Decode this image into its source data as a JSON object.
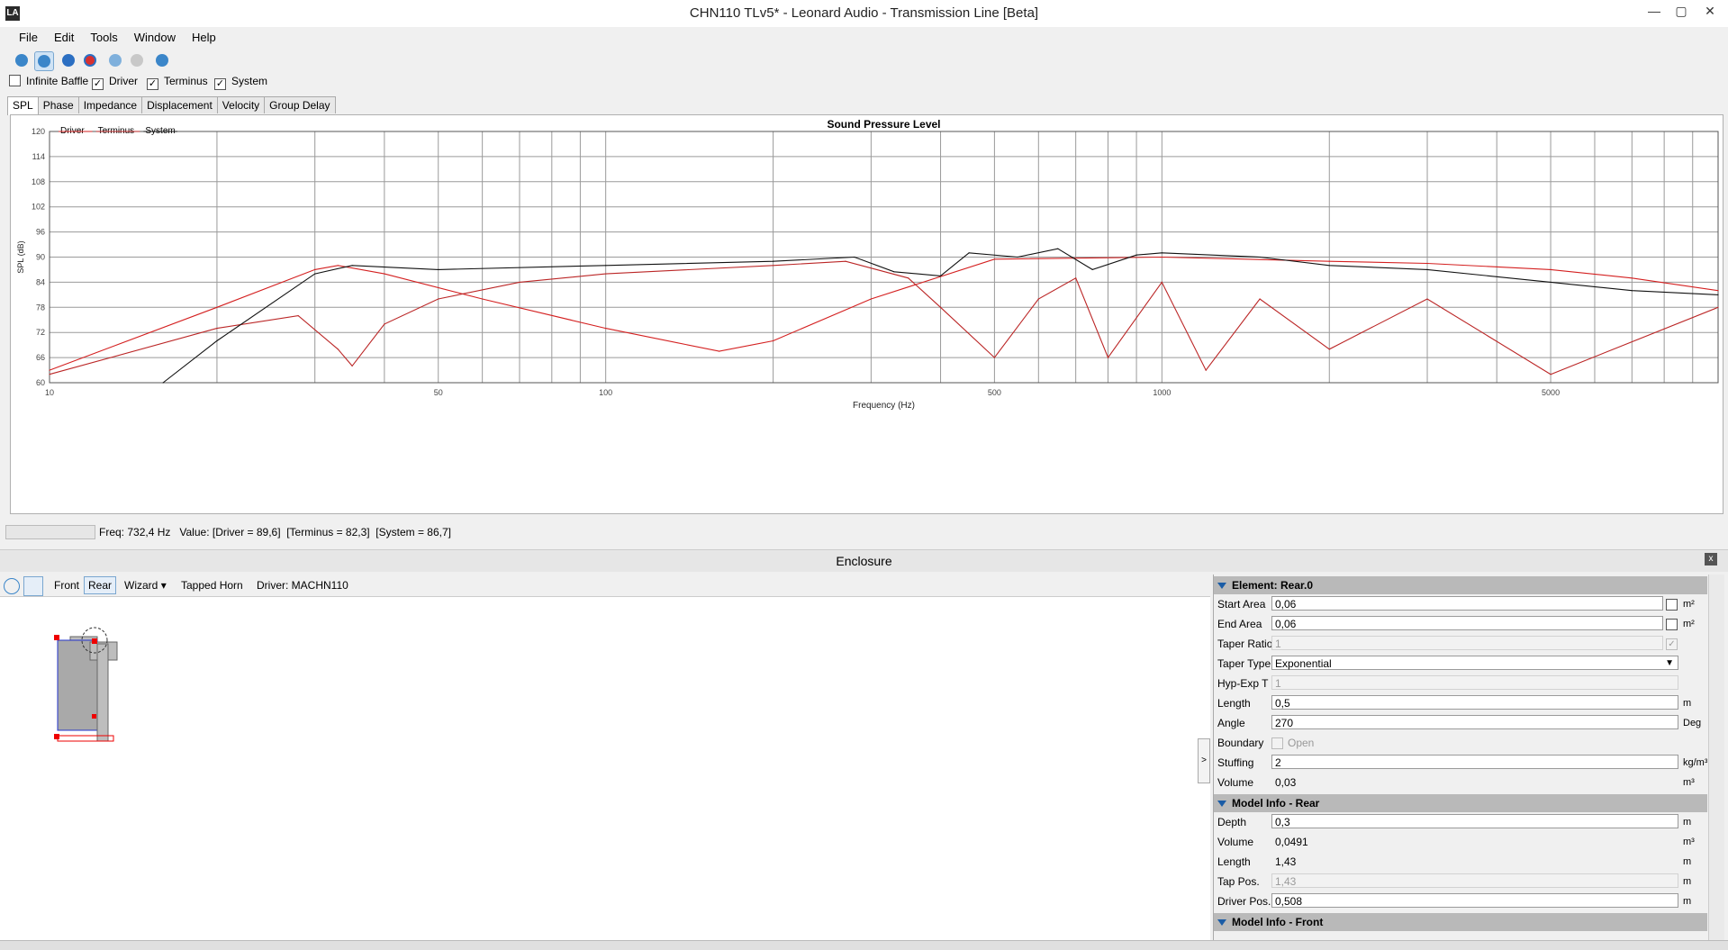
{
  "window": {
    "title": "CHN110 TLv5* - Leonard Audio - Transmission Line [Beta]",
    "logo_text": "LA",
    "minimize": "—",
    "maximize": "▢",
    "close": "✕"
  },
  "menu": [
    "File",
    "Edit",
    "Tools",
    "Window",
    "Help"
  ],
  "toolbar_icons": [
    "zoom-fit-icon",
    "zoom-reset-icon",
    "record-blue-icon",
    "record-red-icon",
    "step-back-icon",
    "step-forward-icon",
    "play-icon"
  ],
  "checkboxes": [
    {
      "label": "Infinite Baffle",
      "checked": false
    },
    {
      "label": "Driver",
      "checked": true
    },
    {
      "label": "Terminus",
      "checked": true
    },
    {
      "label": "System",
      "checked": true
    }
  ],
  "check_mark": "✓",
  "tabs": [
    "SPL",
    "Phase",
    "Impedance",
    "Displacement",
    "Velocity",
    "Group Delay"
  ],
  "active_tab": "SPL",
  "chart_data": {
    "type": "line",
    "title": "Sound Pressure Level",
    "xlabel": "Frequency (Hz)",
    "ylabel": "SPL (dB)",
    "x_scale": "log",
    "xlim": [
      10,
      10000
    ],
    "ylim": [
      60,
      120
    ],
    "x_ticks": [
      10,
      50,
      100,
      500,
      1000,
      5000
    ],
    "x_tick_labels": [
      "10",
      "50",
      "100",
      "500",
      "1000",
      "5000"
    ],
    "y_ticks": [
      60,
      66,
      72,
      78,
      84,
      90,
      96,
      102,
      108,
      114,
      120
    ],
    "y_tick_labels": [
      "60",
      "66",
      "72",
      "78",
      "84",
      "90",
      "96",
      "102",
      "108",
      "114",
      "120"
    ],
    "grid": true,
    "legend": "top-left",
    "series": [
      {
        "name": "Driver",
        "color": "#d42020",
        "x": [
          10,
          20,
          30,
          33,
          40,
          60,
          100,
          160,
          200,
          300,
          500,
          1000,
          2000,
          3000,
          5000,
          7000,
          10000
        ],
        "y": [
          63,
          78,
          87,
          88,
          86,
          80,
          73,
          67.5,
          70,
          80,
          89.5,
          90,
          89,
          88.5,
          87,
          85,
          82
        ]
      },
      {
        "name": "Terminus",
        "color": "#bb2626",
        "x": [
          10,
          20,
          28,
          33,
          35,
          40,
          50,
          70,
          100,
          200,
          270,
          350,
          400,
          500,
          600,
          700,
          800,
          1000,
          1200,
          1500,
          2000,
          3000,
          5000,
          10000
        ],
        "y": [
          62,
          73,
          76,
          68,
          64,
          74,
          80,
          84,
          86,
          88,
          89,
          85,
          78,
          66,
          80,
          85,
          66,
          84,
          63,
          80,
          68,
          80,
          62,
          78
        ]
      },
      {
        "name": "System",
        "color": "#111111",
        "x": [
          16,
          20,
          30,
          35,
          50,
          100,
          200,
          280,
          330,
          400,
          450,
          550,
          650,
          750,
          900,
          1000,
          1500,
          2000,
          3000,
          5000,
          7000,
          10000
        ],
        "y": [
          60,
          70,
          86,
          88,
          87,
          88,
          89,
          90,
          86.5,
          85.5,
          91,
          90,
          92,
          87,
          90.5,
          91,
          90,
          88,
          87,
          84,
          82,
          81
        ]
      }
    ]
  },
  "status": {
    "freq": "Freq: 732,4 Hz",
    "value": "Value: [Driver = 89,6]  [Terminus = 82,3]  [System = 86,7]"
  },
  "enclosure": {
    "title": "Enclosure",
    "close": "x",
    "toolbar": {
      "front": "Front",
      "rear": "Rear",
      "wizard": "Wizard",
      "wizard_arrow": "▾",
      "tapped_horn": "Tapped Horn",
      "driver": "Driver: MACHN110"
    },
    "expander": ">"
  },
  "properties": {
    "element_section": "Element: Rear.0",
    "start_area": {
      "label": "Start Area",
      "value": "0,06",
      "unit": "m²"
    },
    "end_area": {
      "label": "End Area",
      "value": "0,06",
      "unit": "m²"
    },
    "taper_ratio": {
      "label": "Taper Ratio",
      "value": "1"
    },
    "taper_type": {
      "label": "Taper Type",
      "value": "Exponential",
      "arrow": "▼"
    },
    "hyp_exp": {
      "label": "Hyp-Exp T",
      "value": "1"
    },
    "length": {
      "label": "Length",
      "value": "0,5",
      "unit": "m"
    },
    "angle": {
      "label": "Angle",
      "value": "270",
      "unit": "Deg"
    },
    "boundary": {
      "label": "Boundary",
      "value": "Open"
    },
    "stuffing": {
      "label": "Stuffing",
      "value": "2",
      "unit": "kg/m³"
    },
    "volume": {
      "label": "Volume",
      "value": "0,03",
      "unit": "m³"
    },
    "model_rear_section": "Model Info - Rear",
    "depth": {
      "label": "Depth",
      "value": "0,3",
      "unit": "m"
    },
    "rear_volume": {
      "label": "Volume",
      "value": "0,0491",
      "unit": "m³"
    },
    "rear_length": {
      "label": "Length",
      "value": "1,43",
      "unit": "m"
    },
    "tap_pos": {
      "label": "Tap Pos.",
      "value": "1,43",
      "unit": "m"
    },
    "driver_pos": {
      "label": "Driver Pos.",
      "value": "0,508",
      "unit": "m"
    },
    "model_front_section": "Model Info - Front"
  }
}
